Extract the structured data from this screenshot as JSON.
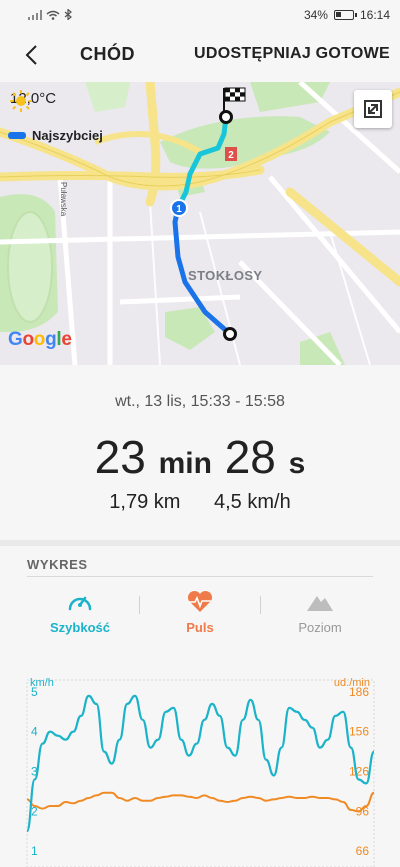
{
  "status_bar": {
    "battery": "34%",
    "battery_level": 0.34,
    "time": "16:14"
  },
  "header": {
    "title": "CHÓD",
    "share_label": "UDOSTĘPNIAJ",
    "done_label": "GOTOWE"
  },
  "map": {
    "temperature": "12,0°C",
    "legend_label": "Najszybciej",
    "district_label": "STOKŁOSY",
    "street_label": "Puławska",
    "marker_1": "1",
    "marker_2": "2",
    "google": {
      "G": "G",
      "o1": "o",
      "o2": "o",
      "g": "g",
      "l": "l",
      "e": "e"
    },
    "colors": {
      "route": "#1a73e8",
      "route_fast": "#19c5d9",
      "road_yellow": "#f7e48a",
      "park": "#c9e8b7"
    }
  },
  "summary": {
    "date_time": "wt., 13 lis, 15:33 - 15:58",
    "duration": {
      "minutes": "23",
      "min_unit": "min",
      "seconds": "28",
      "sec_unit": "s"
    },
    "distance": "1,79 km",
    "speed": "4,5 km/h"
  },
  "chart_section": {
    "title": "WYKRES",
    "tabs": [
      {
        "label": "Szybkość",
        "icon": "speedometer-icon",
        "color": "#1ab3c9"
      },
      {
        "label": "Puls",
        "icon": "heart-pulse-icon",
        "color": "#f07b4a"
      },
      {
        "label": "Poziom",
        "icon": "mountain-icon",
        "color": "#999999"
      }
    ]
  },
  "chart_data": {
    "type": "line",
    "y_left_label": "km/h",
    "y_right_label": "ud./min",
    "y_left_ticks": [
      "5",
      "4",
      "3",
      "2",
      "1"
    ],
    "y_right_ticks": [
      "186",
      "156",
      "126",
      "96",
      "66"
    ],
    "y_left_range": [
      0.6,
      5.3
    ],
    "y_right_range": [
      54,
      195
    ],
    "series": [
      {
        "unit": "km/h",
        "color": "#1ab3c9",
        "values": [
          1.5,
          2.8,
          3.7,
          4.0,
          3.9,
          3.8,
          4.0,
          4.4,
          4.9,
          4.7,
          3.5,
          3.2,
          3.8,
          4.7,
          4.9,
          4.3,
          3.6,
          3.8,
          4.5,
          4.6,
          3.8,
          3.4,
          3.7,
          4.3,
          4.7,
          4.4,
          3.6,
          3.4,
          4.3,
          4.8,
          4.3,
          3.3,
          2.9,
          3.6,
          4.6,
          4.5,
          4.3,
          4.1,
          3.6,
          3.8,
          4.4,
          4.5,
          3.6,
          2.8,
          2.7,
          3.5
        ]
      },
      {
        "unit": "ud./min",
        "color": "#f08a24",
        "values": [
          105,
          100,
          98,
          100,
          100,
          103,
          102,
          104,
          106,
          108,
          110,
          110,
          106,
          104,
          106,
          104,
          104,
          106,
          107,
          108,
          108,
          107,
          106,
          108,
          106,
          104,
          103,
          104,
          106,
          107,
          106,
          104,
          105,
          106,
          107,
          106,
          106,
          107,
          106,
          106,
          105,
          103,
          97,
          96,
          100,
          110
        ]
      }
    ]
  }
}
